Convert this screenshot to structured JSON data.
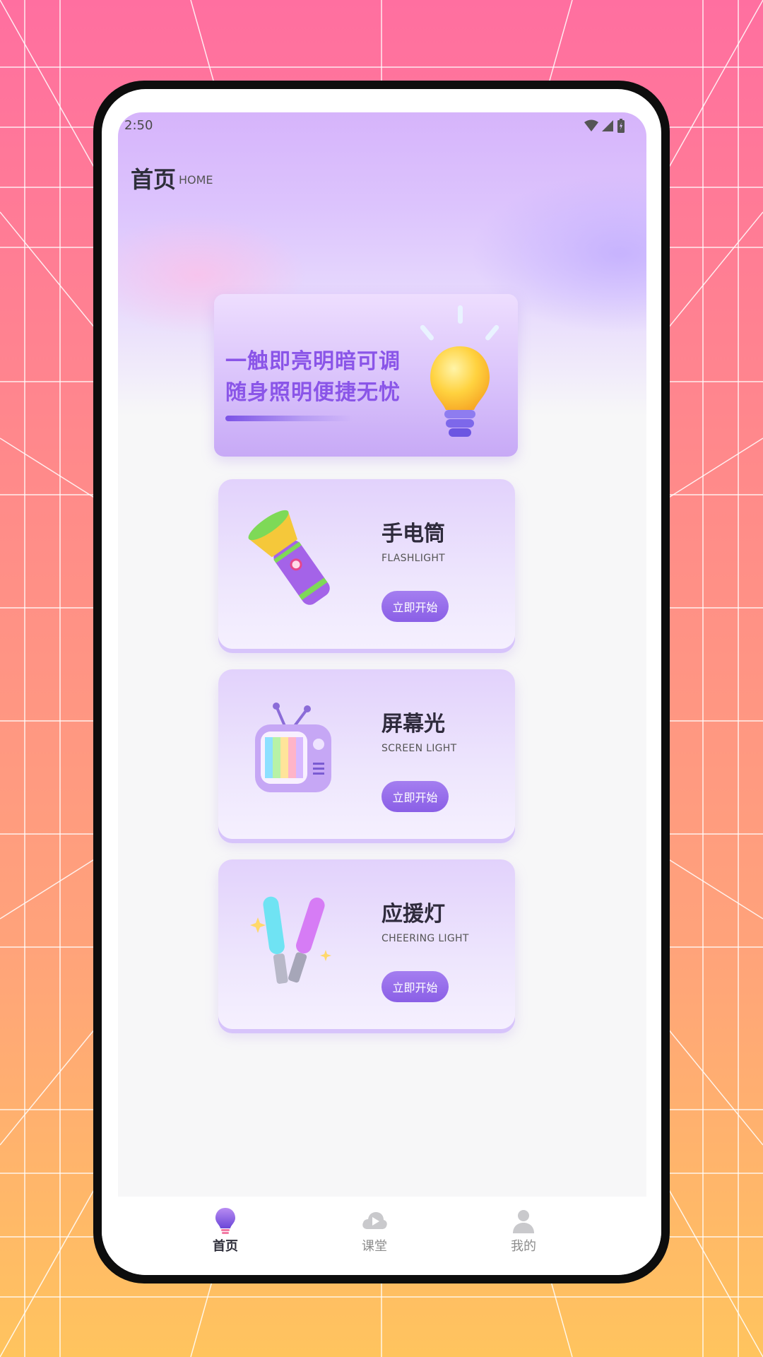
{
  "status_bar": {
    "time": "2:50"
  },
  "header": {
    "title": "首页",
    "subtitle": "HOME"
  },
  "banner": {
    "line1": "一触即亮明暗可调",
    "line2": "随身照明便捷无忧"
  },
  "cards": [
    {
      "title": "手电筒",
      "subtitle": "FLASHLIGHT",
      "button": "立即开始",
      "icon": "flashlight-icon"
    },
    {
      "title": "屏幕光",
      "subtitle": "SCREEN LIGHT",
      "button": "立即开始",
      "icon": "tv-icon"
    },
    {
      "title": "应援灯",
      "subtitle": "CHEERING LIGHT",
      "button": "立即开始",
      "icon": "glowstick-icon"
    }
  ],
  "bottom_nav": {
    "items": [
      {
        "label": "首页",
        "icon": "bulb-icon",
        "active": true
      },
      {
        "label": "课堂",
        "icon": "cloud-play-icon",
        "active": false
      },
      {
        "label": "我的",
        "icon": "person-icon",
        "active": false
      }
    ]
  },
  "colors": {
    "accent": "#8a5fe6",
    "banner_text": "#8a55e8",
    "backdrop_top": "#ff6fa0",
    "backdrop_bottom": "#ffc45e"
  }
}
